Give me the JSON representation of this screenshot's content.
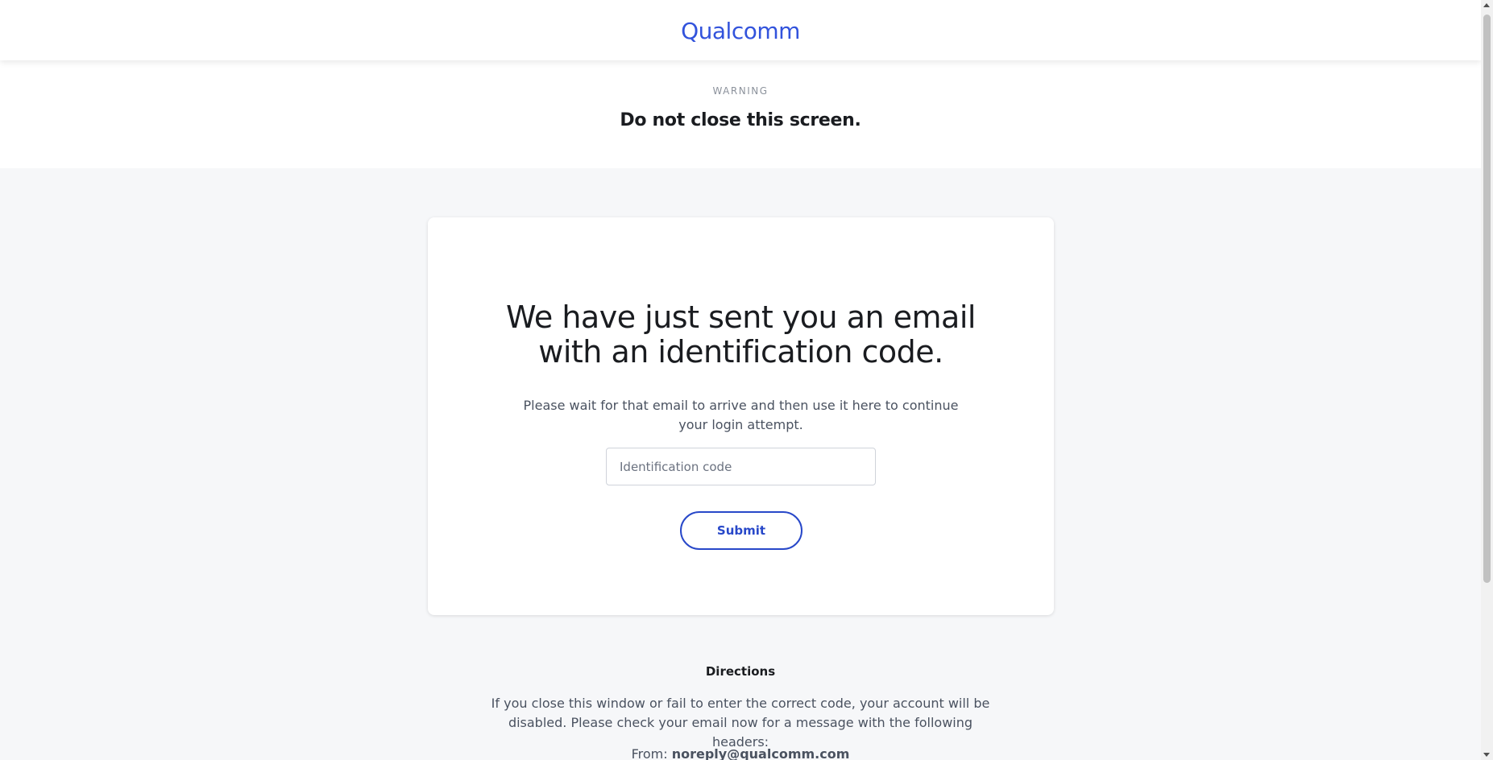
{
  "header": {
    "logo_text": "Qualcomm",
    "brand_color": "#3253dc"
  },
  "warning": {
    "eyebrow": "WARNING",
    "title": "Do not close this screen."
  },
  "card": {
    "headline_line1": "We have just sent you an email",
    "headline_line2": "with an identification code.",
    "instructions": "Please wait for that email to arrive and then use it here to continue your login attempt.",
    "code_input": {
      "value": "",
      "placeholder": "Identification code"
    },
    "submit_label": "Submit"
  },
  "directions": {
    "title": "Directions",
    "text": "If you close this window or fail to enter the correct code, your account will be disabled. Please check your email now for a message with the following headers:",
    "from_label": "From:",
    "from_email": "noreply@qualcomm.com"
  }
}
